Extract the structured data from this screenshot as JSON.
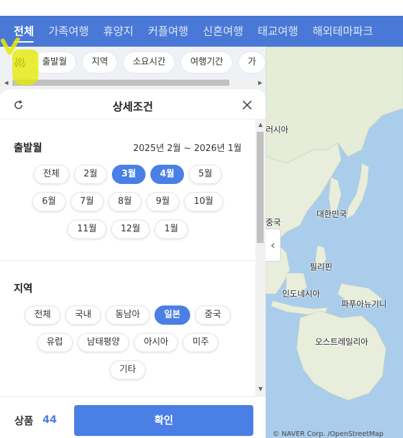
{
  "tabs": [
    {
      "label": "전체",
      "active": true
    },
    {
      "label": "가족여행"
    },
    {
      "label": "휴양지"
    },
    {
      "label": "커플여행"
    },
    {
      "label": "신혼여행"
    },
    {
      "label": "태교여행"
    },
    {
      "label": "해외테마파크"
    }
  ],
  "filters": {
    "icon": "filter-sliders-icon",
    "chips": [
      "출발월",
      "지역",
      "소요시간",
      "여행기간",
      "가"
    ]
  },
  "sheet": {
    "title": "상세조건",
    "reset_icon": "refresh-icon",
    "close_icon": "close-icon"
  },
  "departure": {
    "title": "출발월",
    "range": "2025년 2월 ~ 2026년 1월",
    "rows": [
      [
        {
          "label": "전체"
        },
        {
          "label": "2월"
        },
        {
          "label": "3월",
          "selected": true
        },
        {
          "label": "4월",
          "selected": true
        },
        {
          "label": "5월"
        }
      ],
      [
        {
          "label": "6월"
        },
        {
          "label": "7월"
        },
        {
          "label": "8월"
        },
        {
          "label": "9월"
        },
        {
          "label": "10월"
        }
      ],
      [
        {
          "label": "11월"
        },
        {
          "label": "12월"
        },
        {
          "label": "1월"
        }
      ]
    ]
  },
  "region": {
    "title": "지역",
    "rows": [
      [
        {
          "label": "전체"
        },
        {
          "label": "국내"
        },
        {
          "label": "동남아"
        },
        {
          "label": "일본",
          "selected": true
        },
        {
          "label": "중국"
        }
      ],
      [
        {
          "label": "유럽"
        },
        {
          "label": "남태평양"
        },
        {
          "label": "아시아"
        },
        {
          "label": "미주"
        }
      ],
      [
        {
          "label": "기타"
        }
      ]
    ]
  },
  "footer": {
    "count_label": "상품",
    "count_value": "44",
    "confirm_label": "확인"
  },
  "map": {
    "labels": {
      "russia": "러시아",
      "korea": "대한민국",
      "china": "중국",
      "philippines": "필리핀",
      "indonesia": "인도네시아",
      "png": "파푸아뉴기니",
      "australia": "오스트레일리아"
    },
    "attribution": "© NAVER Corp. /OpenStreetMap",
    "collapse_icon": "chevron-left-icon"
  },
  "colors": {
    "brand": "#4a78d6",
    "accent": "#4a7fe5",
    "highlight": "#e6eb00"
  }
}
